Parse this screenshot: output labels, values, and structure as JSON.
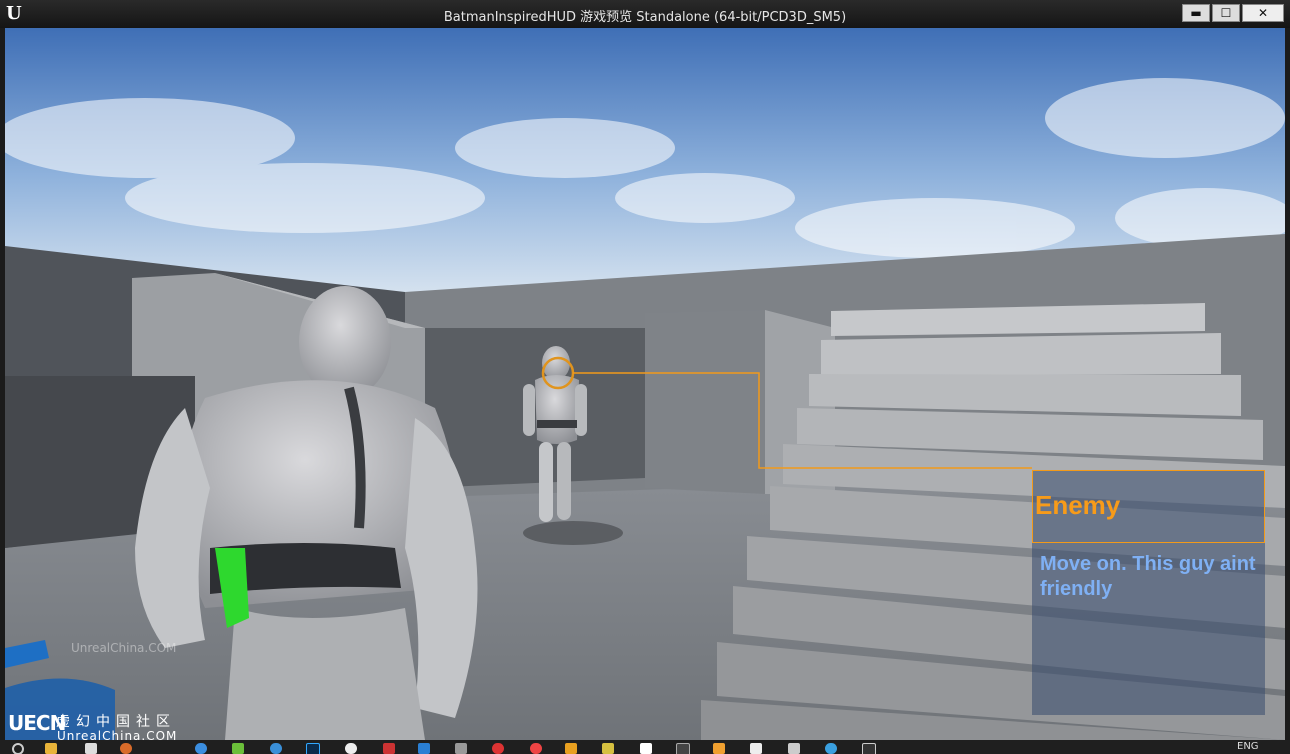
{
  "window": {
    "title": "BatmanInspiredHUD 游戏预览 Standalone (64-bit/PCD3D_SM5)",
    "logo_glyph": "U",
    "minimize_glyph": "▬",
    "maximize_glyph": "☐",
    "close_glyph": "✕"
  },
  "hud": {
    "popup_title": "Enemy",
    "popup_message": "Move on. This guy aint friendly",
    "accent_color": "#f79b19",
    "message_color": "#7fb0f4"
  },
  "watermark": {
    "small": "UnrealChina.COM",
    "logo": "UECN",
    "cn": "虚幻中国社区",
    "url": "UnrealChina.COM"
  },
  "taskbar": {
    "language": "ENG",
    "icons": [
      "search-icon",
      "file-explorer-icon",
      "store-icon",
      "app-icon",
      "chrome-icon",
      "photoshop-icon",
      "unity-icon",
      "unreal-icon",
      "epic-icon"
    ]
  }
}
